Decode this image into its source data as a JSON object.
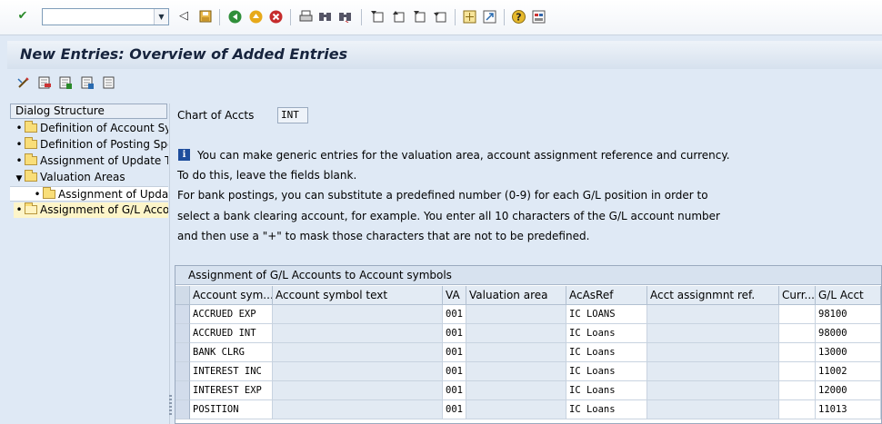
{
  "toolbar": {
    "command_field": "",
    "icons": [
      "enter-icon",
      "back-icon",
      "save-icon",
      "back-green-icon",
      "exit-icon",
      "cancel-icon",
      "print-icon",
      "find-icon",
      "find-next-icon",
      "first-page-icon",
      "prev-page-icon",
      "next-page-icon",
      "last-page-icon",
      "new-session-icon",
      "shortcut-icon",
      "help-icon",
      "customize-layout-icon"
    ]
  },
  "title": "New Entries: Overview of Added Entries",
  "app_toolbar": {
    "icons": [
      "change-display-icon",
      "delete-icon",
      "select-all-icon",
      "select-block-icon",
      "deselect-all-icon"
    ]
  },
  "dialog": {
    "header": "Dialog Structure",
    "items": [
      {
        "label": "Definition of Account Sy"
      },
      {
        "label": "Definition of Posting Spe"
      },
      {
        "label": "Assignment of Update T"
      },
      {
        "label": "Valuation Areas"
      },
      {
        "label": "Assignment of Updat"
      },
      {
        "label": "Assignment of G/L Acco"
      }
    ]
  },
  "main": {
    "coa_label": "Chart of Accts",
    "coa_value": "INT",
    "info_lines": [
      "You can make generic entries for the valuation area, account assignment reference and currency.",
      "To do this, leave the fields blank.",
      "For bank postings, you can substitute a predefined number (0-9) for each G/L position in order to",
      "select a bank clearing account, for example. You enter all 10 characters of the G/L account number",
      "and then use a \"+\" to mask those characters that are not to be predefined."
    ]
  },
  "table": {
    "caption": "Assignment of G/L Accounts to Account symbols",
    "columns": [
      "Account sym...",
      "Account symbol text",
      "VA",
      "Valuation area",
      "AcAsRef",
      "Acct assignmnt ref.",
      "Curr...",
      "G/L Acct"
    ],
    "rows": [
      [
        "ACCRUED EXP",
        "",
        "001",
        "",
        "IC LOANS",
        "",
        "",
        "98100"
      ],
      [
        "ACCRUED INT",
        "",
        "001",
        "",
        "IC Loans",
        "",
        "",
        "98000"
      ],
      [
        "BANK CLRG",
        "",
        "001",
        "",
        "IC Loans",
        "",
        "",
        "13000"
      ],
      [
        "INTEREST INC",
        "",
        "001",
        "",
        "IC Loans",
        "",
        "",
        "11002"
      ],
      [
        "INTEREST EXP",
        "",
        "001",
        "",
        "IC Loans",
        "",
        "",
        "12000"
      ],
      [
        "POSITION",
        "",
        "001",
        "",
        "IC Loans",
        "",
        "",
        "11013"
      ]
    ]
  },
  "colors": {
    "background": "#dfe9f5",
    "title_text": "#17243d",
    "selection": "#fdf5c9"
  }
}
